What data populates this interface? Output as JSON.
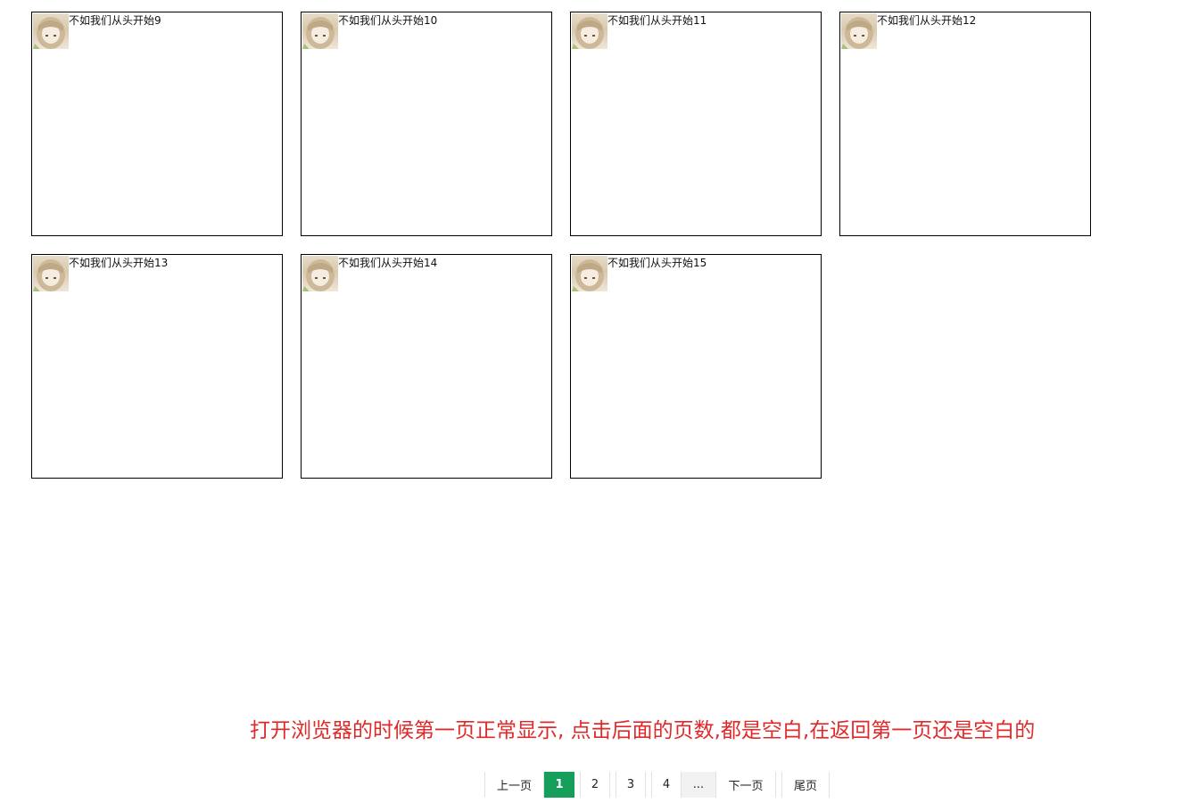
{
  "cards": [
    {
      "title": "不如我们从头开始9"
    },
    {
      "title": "不如我们从头开始10"
    },
    {
      "title": "不如我们从头开始11"
    },
    {
      "title": "不如我们从头开始12"
    },
    {
      "title": "不如我们从头开始13"
    },
    {
      "title": "不如我们从头开始14"
    },
    {
      "title": "不如我们从头开始15"
    }
  ],
  "notice": "打开浏览器的时候第一页正常显示, 点击后面的页数,都是空白,在返回第一页还是空白的",
  "pagination": {
    "prev": "上一页",
    "pages": [
      "1",
      "2",
      "3",
      "4"
    ],
    "current": "1",
    "ellipsis": "...",
    "next": "下一页",
    "last": "尾页"
  },
  "colors": {
    "active_page": "#169f5a",
    "notice_text": "#e02a2a"
  },
  "icons": {
    "avatar": "girl-avatar-icon"
  }
}
